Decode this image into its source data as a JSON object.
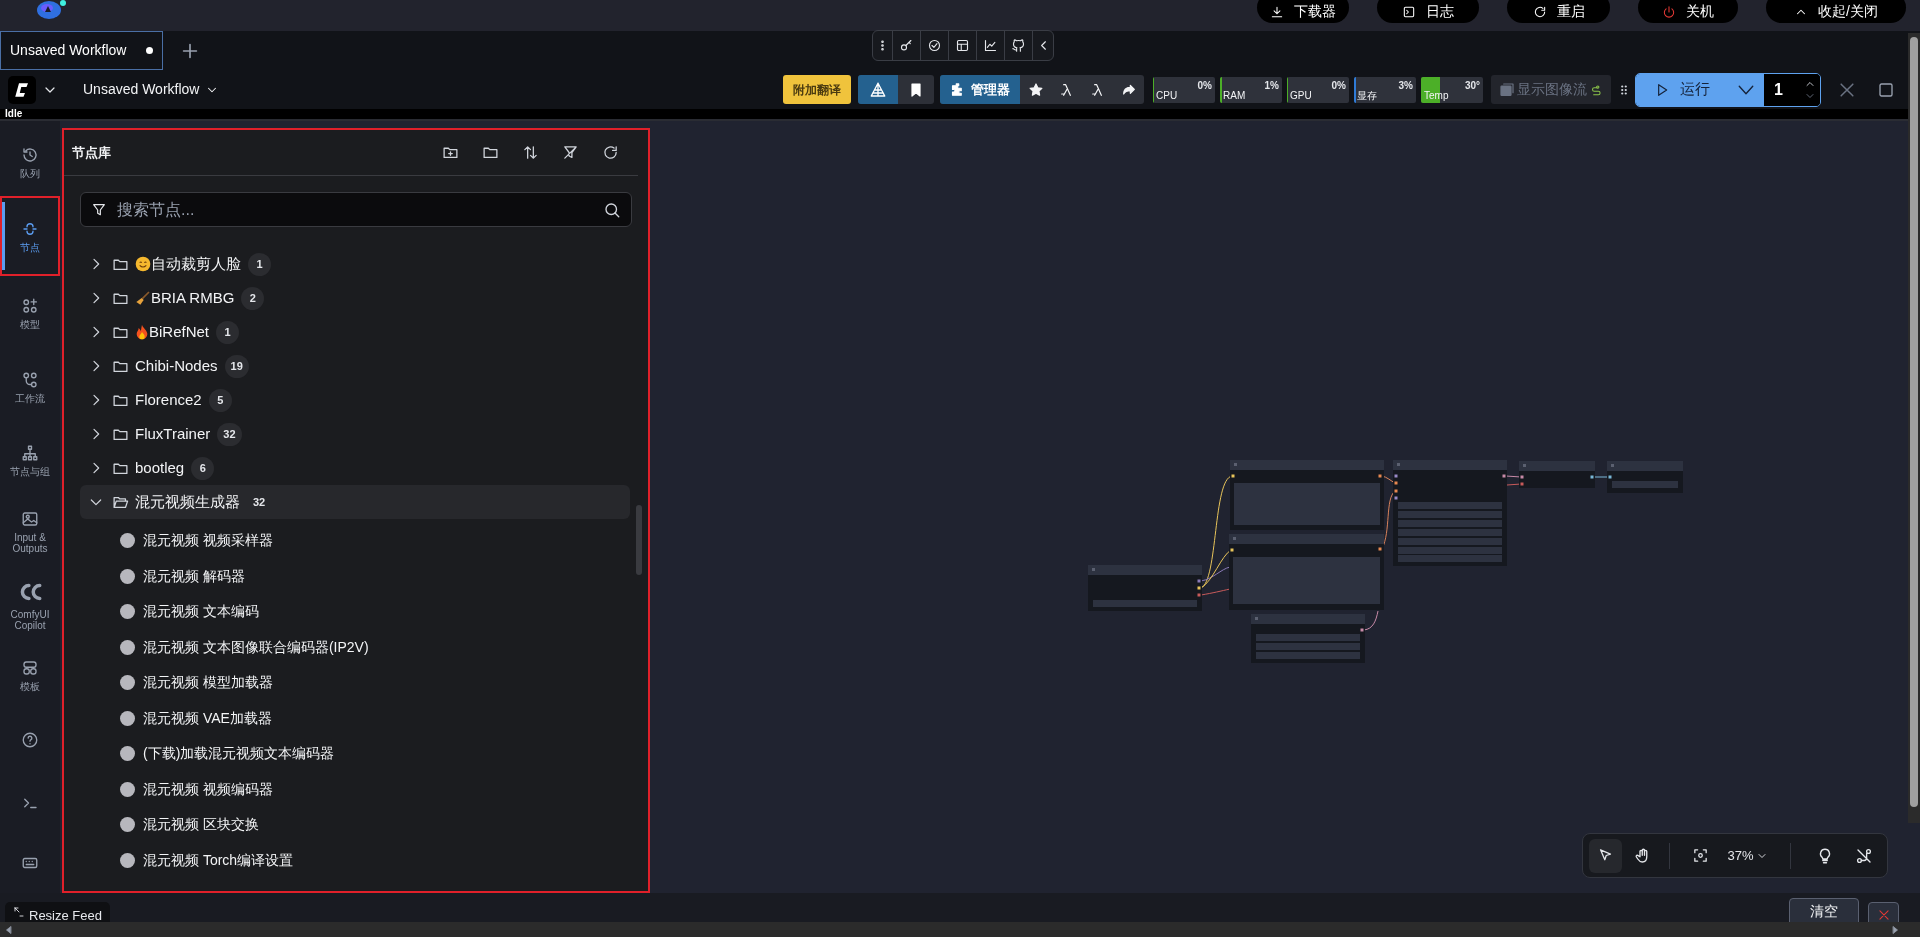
{
  "top_bar": {
    "buttons": [
      {
        "kind": "download",
        "label": "下载器"
      },
      {
        "kind": "terminal",
        "label": "日志"
      },
      {
        "kind": "restart",
        "label": "重启"
      },
      {
        "kind": "power",
        "label": "关机"
      },
      {
        "kind": "collapse",
        "label": "收起/关闭"
      }
    ]
  },
  "tabs": [
    {
      "label": "Unsaved Workflow",
      "unsaved": true,
      "selected": true
    }
  ],
  "menu_bar": {
    "workflow_name": "Unsaved Workflow",
    "translate_button": "附加翻译",
    "manager_button": "管理器",
    "monitors": [
      {
        "label": "CPU",
        "reading": "0%",
        "level": 0,
        "color": "#4caf28"
      },
      {
        "label": "RAM",
        "reading": "1%",
        "level": 0.01,
        "color": "#4caf28"
      },
      {
        "label": "GPU",
        "reading": "0%",
        "level": 0,
        "color": "#4caf28"
      },
      {
        "label": "显存",
        "reading": "3%",
        "level": 0.03,
        "color": "#2f7bd6"
      },
      {
        "label": "Temp",
        "reading": "30°",
        "level": 0.3,
        "color": "#4caf28"
      }
    ],
    "image_feed_button": "显示图像流",
    "run_button": "运行",
    "batch_count": "1"
  },
  "status": "Idle",
  "sidebar": {
    "items": [
      {
        "kind": "history",
        "label": "队列",
        "selected": false
      },
      {
        "kind": "nodes",
        "label": "节点",
        "selected": true
      },
      {
        "kind": "model",
        "label": "模型",
        "selected": false
      },
      {
        "kind": "workflow",
        "label": "工作流",
        "selected": false
      },
      {
        "kind": "node-group",
        "label": "节点与组",
        "selected": false
      },
      {
        "kind": "image",
        "label": "Input & Outputs",
        "selected": false
      },
      {
        "kind": "copilot",
        "label": "ComfyUI Copilot",
        "selected": false
      },
      {
        "kind": "template",
        "label": "模板",
        "selected": false
      },
      {
        "kind": "help",
        "selected": false
      },
      {
        "kind": "terminal",
        "selected": false
      },
      {
        "kind": "keyboard",
        "selected": false
      }
    ]
  },
  "node_library": {
    "title": "节点库",
    "search_placeholder": "搜索节点...",
    "items": [
      {
        "kind": "smiley",
        "label": "自动裁剪人脸",
        "count": "1",
        "expanded": false
      },
      {
        "kind": "broom",
        "label": "BRIA RMBG",
        "count": "2",
        "expanded": false
      },
      {
        "kind": "flame",
        "label": "BiRefNet",
        "count": "1",
        "expanded": false
      },
      {
        "kind": "plain",
        "label": "Chibi-Nodes",
        "count": "19",
        "expanded": false
      },
      {
        "kind": "plain",
        "label": "Florence2",
        "count": "5",
        "expanded": false
      },
      {
        "kind": "plain",
        "label": "FluxTrainer",
        "count": "32",
        "expanded": false
      },
      {
        "kind": "plain",
        "label": "bootleg",
        "count": "6",
        "expanded": false
      },
      {
        "kind": "plain",
        "label": "混元视频生成器",
        "count": "32",
        "expanded": true,
        "children": [
          {
            "label": "混元视频 视频采样器"
          },
          {
            "label": "混元视频 解码器"
          },
          {
            "label": "混元视频 文本编码"
          },
          {
            "label": "混元视频 文本图像联合编码器(IP2V)"
          },
          {
            "label": "混元视频 模型加载器"
          },
          {
            "label": "混元视频 VAE加载器"
          },
          {
            "label": "(下载)加载混元视频文本编码器"
          },
          {
            "label": "混元视频 视频编码器"
          },
          {
            "label": "混元视频 区块交换"
          },
          {
            "label": "混元视频 Torch编译设置"
          }
        ]
      }
    ]
  },
  "canvas_controls": {
    "zoom": "37%"
  },
  "footer": {
    "resize_button": "Resize Feed",
    "clear_button": "清空"
  }
}
